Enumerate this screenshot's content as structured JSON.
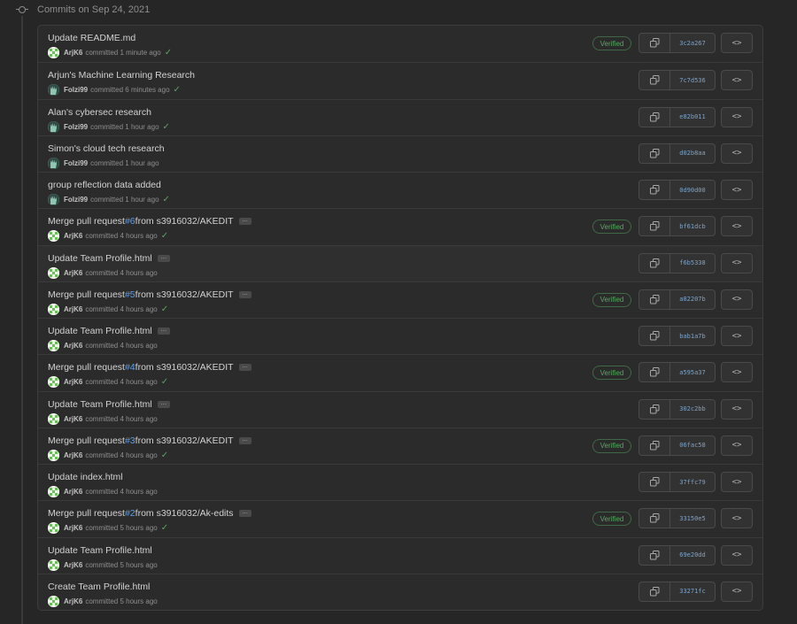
{
  "header": {
    "title": "Commits on Sep 24, 2021"
  },
  "labels": {
    "committed": "committed",
    "verified": "Verified",
    "ellipsis": "…"
  },
  "icons": {
    "commit": "git-commit-icon",
    "copy": "copy-icon",
    "browse": "code-brackets-icon",
    "check": "check-icon",
    "avatar_arjk6": "identicon-avatar",
    "avatar_folzi99": "hand-avatar"
  },
  "colors": {
    "link": "#5f9fe6",
    "verified": "#5aa663",
    "sha": "#7ea3c8"
  },
  "commits": [
    {
      "title_pre": "Update README.md",
      "pr": "",
      "title_post": "",
      "author": "ArjK6",
      "avatar": "arjk6",
      "time": "1 minute ago",
      "sha": "3c2a267",
      "verified": true,
      "check": true,
      "ellipsis": false
    },
    {
      "title_pre": "Arjun's Machine Learning Research",
      "pr": "",
      "title_post": "",
      "author": "Folzi99",
      "avatar": "folzi99",
      "time": "6 minutes ago",
      "sha": "7c7d536",
      "verified": false,
      "check": true,
      "ellipsis": false
    },
    {
      "title_pre": "Alan's cybersec research",
      "pr": "",
      "title_post": "",
      "author": "Folzi99",
      "avatar": "folzi99",
      "time": "1 hour ago",
      "sha": "e82b011",
      "verified": false,
      "check": true,
      "ellipsis": false
    },
    {
      "title_pre": "Simon's cloud tech research",
      "pr": "",
      "title_post": "",
      "author": "Folzi99",
      "avatar": "folzi99",
      "time": "1 hour ago",
      "sha": "d02b8aa",
      "verified": false,
      "check": false,
      "ellipsis": false
    },
    {
      "title_pre": "group reflection data added",
      "pr": "",
      "title_post": "",
      "author": "Folzi99",
      "avatar": "folzi99",
      "time": "1 hour ago",
      "sha": "0d90d00",
      "verified": false,
      "check": true,
      "ellipsis": false
    },
    {
      "title_pre": "Merge pull request ",
      "pr": "#6",
      "title_post": " from s3916032/AKEDIT",
      "author": "ArjK6",
      "avatar": "arjk6",
      "time": "4 hours ago",
      "sha": "bf61dcb",
      "verified": true,
      "check": true,
      "ellipsis": true
    },
    {
      "title_pre": "Update Team Profile.html",
      "pr": "",
      "title_post": "",
      "author": "ArjK6",
      "avatar": "arjk6",
      "time": "4 hours ago",
      "sha": "f6b5338",
      "verified": false,
      "check": false,
      "ellipsis": true,
      "hover": true
    },
    {
      "title_pre": "Merge pull request ",
      "pr": "#5",
      "title_post": " from s3916032/AKEDIT",
      "author": "ArjK6",
      "avatar": "arjk6",
      "time": "4 hours ago",
      "sha": "a82207b",
      "verified": true,
      "check": true,
      "ellipsis": true
    },
    {
      "title_pre": "Update Team Profile.html",
      "pr": "",
      "title_post": "",
      "author": "ArjK6",
      "avatar": "arjk6",
      "time": "4 hours ago",
      "sha": "bab1a7b",
      "verified": false,
      "check": false,
      "ellipsis": true
    },
    {
      "title_pre": "Merge pull request ",
      "pr": "#4",
      "title_post": " from s3916032/AKEDIT",
      "author": "ArjK6",
      "avatar": "arjk6",
      "time": "4 hours ago",
      "sha": "a595a37",
      "verified": true,
      "check": true,
      "ellipsis": true
    },
    {
      "title_pre": "Update Team Profile.html",
      "pr": "",
      "title_post": "",
      "author": "ArjK6",
      "avatar": "arjk6",
      "time": "4 hours ago",
      "sha": "302c2bb",
      "verified": false,
      "check": false,
      "ellipsis": true
    },
    {
      "title_pre": "Merge pull request ",
      "pr": "#3",
      "title_post": " from s3916032/AKEDIT",
      "author": "ArjK6",
      "avatar": "arjk6",
      "time": "4 hours ago",
      "sha": "06fac58",
      "verified": true,
      "check": true,
      "ellipsis": true
    },
    {
      "title_pre": "Update index.html",
      "pr": "",
      "title_post": "",
      "author": "ArjK6",
      "avatar": "arjk6",
      "time": "4 hours ago",
      "sha": "37ffc79",
      "verified": false,
      "check": false,
      "ellipsis": false
    },
    {
      "title_pre": "Merge pull request ",
      "pr": "#2",
      "title_post": " from s3916032/Ak-edits",
      "author": "ArjK6",
      "avatar": "arjk6",
      "time": "5 hours ago",
      "sha": "33150e5",
      "verified": true,
      "check": true,
      "ellipsis": true
    },
    {
      "title_pre": "Update Team Profile.html",
      "pr": "",
      "title_post": "",
      "author": "ArjK6",
      "avatar": "arjk6",
      "time": "5 hours ago",
      "sha": "69e20dd",
      "verified": false,
      "check": false,
      "ellipsis": false
    },
    {
      "title_pre": "Create Team Profile.html",
      "pr": "",
      "title_post": "",
      "author": "ArjK6",
      "avatar": "arjk6",
      "time": "5 hours ago",
      "sha": "33271fc",
      "verified": false,
      "check": false,
      "ellipsis": false
    }
  ]
}
